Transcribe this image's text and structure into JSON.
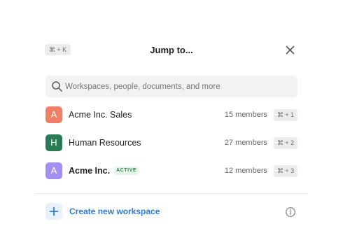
{
  "header": {
    "shortcut": "⌘ + K",
    "title": "Jump to..."
  },
  "search": {
    "placeholder": "Workspaces, people, documents, and more",
    "value": ""
  },
  "workspaces": [
    {
      "initial": "A",
      "name": "Acme Inc. Sales",
      "members": "15 members",
      "shortcut": "⌘ + 1",
      "color": "#f17f68",
      "active": false
    },
    {
      "initial": "H",
      "name": "Human Resources",
      "members": "27 members",
      "shortcut": "⌘ + 2",
      "color": "#2a7a55",
      "active": false
    },
    {
      "initial": "A",
      "name": "Acme Inc.",
      "members": "12 members",
      "shortcut": "⌘ + 3",
      "color": "#a58ef2",
      "active": true,
      "badge": "ACTIVE"
    }
  ],
  "footer": {
    "create_label": "Create new workspace"
  },
  "icons": {
    "close": "close-icon",
    "search": "search-icon",
    "plus": "plus-icon",
    "info": "info-icon"
  },
  "colors": {
    "accent": "#2e7be2",
    "active_badge_text": "#2f8a4c",
    "active_badge_bg": "#e7f5ec"
  }
}
